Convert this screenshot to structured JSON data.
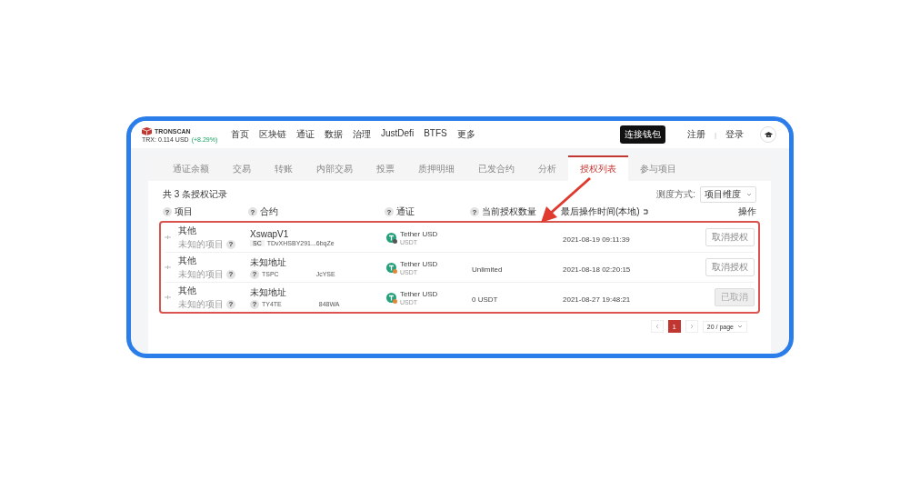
{
  "header": {
    "logo": "TRONSCAN",
    "price": "TRX: 0.114 USD",
    "change": "(+8.29%)",
    "nav": [
      "首页",
      "区块链",
      "通证",
      "数据",
      "治理",
      "JustDefi",
      "BTFS",
      "更多"
    ],
    "connect_button": "连接钱包",
    "register": "注册",
    "separator": "|",
    "login": "登录"
  },
  "tabs": [
    {
      "label": "通证余额",
      "selected": false
    },
    {
      "label": "交易",
      "selected": false
    },
    {
      "label": "转账",
      "selected": false
    },
    {
      "label": "内部交易",
      "selected": false
    },
    {
      "label": "投票",
      "selected": false
    },
    {
      "label": "质押明细",
      "selected": false
    },
    {
      "label": "已发合约",
      "selected": false
    },
    {
      "label": "分析",
      "selected": false
    },
    {
      "label": "授权列表",
      "selected": true
    },
    {
      "label": "参与项目",
      "selected": false
    }
  ],
  "summary": "共 3 条授权记录",
  "view_mode": {
    "label": "测度方式:",
    "value": "项目维度"
  },
  "columns": [
    {
      "label": "项目",
      "kind": "help",
      "help": "?"
    },
    {
      "label": "合约",
      "kind": "help",
      "help": "?"
    },
    {
      "label": "通证",
      "kind": "help",
      "help": "?"
    },
    {
      "label": "当前授权数量",
      "kind": "help",
      "help": "?"
    },
    {
      "label": "最后操作时间(本地)",
      "kind": "time"
    },
    {
      "label": "操作",
      "kind": "plain"
    }
  ],
  "rows": [
    {
      "project": "其他",
      "project_sub": "未知的项目",
      "project_help": "?",
      "contract_name": "XswapV1",
      "contract_badge": "SC",
      "address_start": "TDvXHSBY291...6bqZe",
      "token_name": "Tether USD",
      "token_symbol": "USDT",
      "color": "#555555",
      "time": "2021-08-19 09:11:39",
      "action": "取消授权",
      "disabled": false
    },
    {
      "project": "其他",
      "project_sub": "未知的项目",
      "project_help": "?",
      "contract_name": "未知地址",
      "contract_help": "?",
      "address_start": "TSPC",
      "address_end": "JcYSE",
      "token_name": "Tether USD",
      "token_symbol": "USDT",
      "color": "#e0883a",
      "quantity": "Unlimited",
      "time": "2021-08-18 02:20:15",
      "action": "取消授权",
      "disabled": false
    },
    {
      "project": "其他",
      "project_sub": "未知的项目",
      "project_help": "?",
      "contract_name": "未知地址",
      "contract_help": "?",
      "address_start": "TY4TE",
      "address_end": "848WA",
      "token_name": "Tether USD",
      "token_symbol": "USDT",
      "color": "#e0883a",
      "quantity": "0 USDT",
      "time": "2021-08-27 19:48:21",
      "action": "已取消",
      "disabled": true
    }
  ],
  "pagination": {
    "pages": [
      {
        "label": "1",
        "selected": true
      }
    ],
    "page_size": "20 / page"
  }
}
